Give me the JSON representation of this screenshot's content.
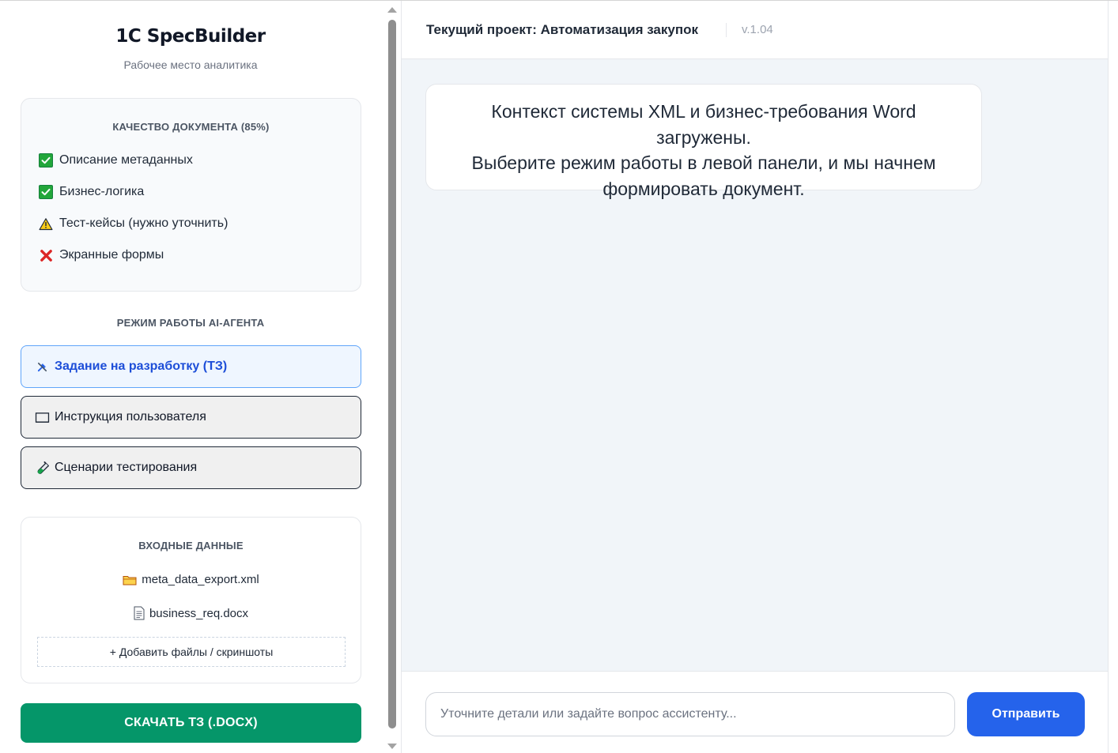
{
  "sidebar": {
    "brand": "1C SpecBuilder",
    "subtitle": "Рабочее место аналитика",
    "quality": {
      "title": "КАЧЕСТВО ДОКУМЕНТА (85%)",
      "items": [
        {
          "label": "Описание метаданных",
          "status": "done",
          "icon": "check-icon"
        },
        {
          "label": "Бизнес-логика",
          "status": "done",
          "icon": "check-icon"
        },
        {
          "label": "Тест-кейсы (нужно уточнить)",
          "status": "warning",
          "icon": "warning-icon"
        },
        {
          "label": "Экранные формы",
          "status": "missing",
          "icon": "cross-icon"
        }
      ]
    },
    "mode": {
      "title": "РЕЖИМ РАБОТЫ AI-АГЕНТА",
      "options": [
        {
          "label": "Задание на разработку (ТЗ)",
          "icon": "tools-icon",
          "active": true
        },
        {
          "label": "Инструкция пользователя",
          "icon": "book-icon",
          "active": false
        },
        {
          "label": "Сценарии тестирования",
          "icon": "test-tube-icon",
          "active": false
        }
      ]
    },
    "inputs": {
      "title": "ВХОДНЫЕ ДАННЫЕ",
      "files": [
        {
          "name": "meta_data_export.xml",
          "icon": "folder-icon"
        },
        {
          "name": "business_req.docx",
          "icon": "document-icon"
        }
      ],
      "add_label": "+ Добавить файлы / скриншоты"
    },
    "download_label": "СКАЧАТЬ ТЗ (.DOCX)"
  },
  "header": {
    "project": "Текущий проект: Автоматизация закупок",
    "version": "v.1.04"
  },
  "chat": {
    "messages": [
      {
        "line1": "Контекст системы XML и бизнес-требования Word загружены.",
        "line2": "Выберите режим работы в левой панели, и мы начнем",
        "line3": "формировать документ."
      }
    ],
    "input_placeholder": "Уточните детали или задайте вопрос ассистенту...",
    "send_label": "Отправить"
  },
  "colors": {
    "accent": "#2563eb",
    "download": "#059669",
    "active_mode_bg": "#eff6ff",
    "active_mode_border": "#60a5fa"
  }
}
